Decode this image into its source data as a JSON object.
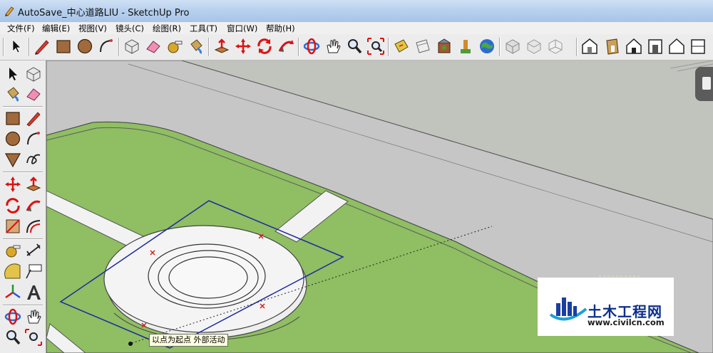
{
  "window": {
    "title": "AutoSave_中心道路LIU - SketchUp Pro",
    "icon": "sketchup-pencil-icon"
  },
  "menu": [
    "文件(F)",
    "编辑(E)",
    "视图(V)",
    "镜头(C)",
    "绘图(R)",
    "工具(T)",
    "窗口(W)",
    "帮助(H)"
  ],
  "toolbar": {
    "tools": [
      "select-arrow-icon",
      "pencil-line-icon",
      "rectangle-icon",
      "circle-icon",
      "arc-icon",
      "make-component-icon",
      "eraser-icon",
      "tape-measure-icon",
      "paint-bucket-icon",
      "push-pull-icon",
      "move-icon",
      "rotate-icon",
      "follow-me-icon",
      "orbit-icon",
      "pan-hand-icon",
      "zoom-icon",
      "zoom-extents-icon",
      "section-plane-icon",
      "display-section-icon",
      "get-models-icon",
      "share-model-icon",
      "geo-location-icon",
      "view-iso-icon",
      "view-iso2-icon",
      "view-iso3-icon",
      "view-top-icon",
      "view-front-icon",
      "view-right-icon",
      "view-back-icon",
      "view-left-icon",
      "view-bottom-icon"
    ]
  },
  "left_tools": [
    "select-arrow-icon",
    "make-component-icon",
    "paint-bucket-icon",
    "eraser-icon",
    "rectangle-icon",
    "pencil-line-icon",
    "circle-icon",
    "arc-icon",
    "polygon-icon",
    "freehand-icon",
    "move-icon",
    "push-pull-icon",
    "rotate-icon",
    "follow-me-icon",
    "scale-icon",
    "offset-icon",
    "tape-measure-icon",
    "dimension-icon",
    "protractor-icon",
    "text-label-icon",
    "axes-icon",
    "3d-text-icon",
    "orbit-icon",
    "pan-hand-icon",
    "zoom-icon",
    "zoom-extents-icon"
  ],
  "viewport": {
    "tooltip": "以点为起点  外部活动",
    "colors": {
      "road": "#c6c6c6",
      "grass": "#8fbe63",
      "sky": "#c7c7c7",
      "selection": "#1c2b9e",
      "marker": "#d62020"
    }
  },
  "watermark": {
    "name": "土木工程网",
    "url": "www.civilcn.com"
  }
}
